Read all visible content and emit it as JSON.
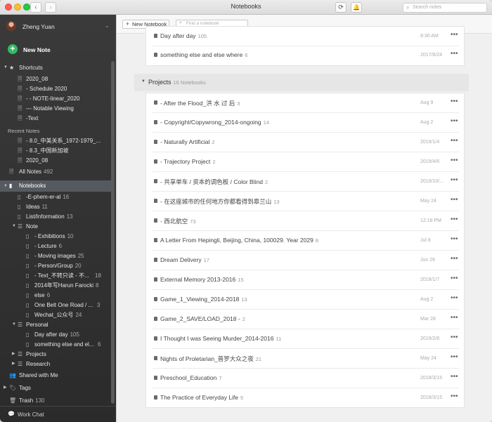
{
  "window": {
    "title": "Notebooks"
  },
  "toolbar": {
    "search_placeholder": "Search notes",
    "back_glyph": "‹",
    "forward_glyph": "›",
    "sync_glyph": "⟳",
    "bell_glyph": "🔔"
  },
  "account": {
    "name": "Zheng Yuan"
  },
  "sidebar": {
    "new_note": "New Note",
    "shortcuts_label": "Shortcuts",
    "shortcuts": [
      "2020_08",
      "- Schedule 2020",
      "- - NOTE-linear_2020",
      "--- Notable Viewing",
      "-Text"
    ],
    "recent_label": "Recent Notes",
    "recent": [
      "- 8.0_中美关系_1972-1979_...",
      "- 8.3_中国新加坡",
      "2020_08"
    ],
    "all_notes": {
      "label": "All Notes",
      "count": "492"
    },
    "notebooks_label": "Notebooks",
    "tree": [
      {
        "name": "-E-phem-er-al",
        "count": "16"
      },
      {
        "name": "Ideas",
        "count": "11"
      },
      {
        "name": "List/Information",
        "count": "13"
      },
      {
        "name": "Note",
        "count": ""
      },
      {
        "name": "- Exhibitions",
        "count": "10"
      },
      {
        "name": "- Lecture",
        "count": "6"
      },
      {
        "name": "- Moving images",
        "count": "25"
      },
      {
        "name": "- Person/Group",
        "count": "20"
      },
      {
        "name": "- Text_不转只读 - 不...",
        "count": "18"
      },
      {
        "name": "2014年写Harun Farocki",
        "count": "8"
      },
      {
        "name": "else",
        "count": "6"
      },
      {
        "name": "One Belt One Road / ...",
        "count": "3"
      },
      {
        "name": "Wechat_公众号",
        "count": "24"
      },
      {
        "name": "Personal",
        "count": ""
      },
      {
        "name": "Day after day",
        "count": "105"
      },
      {
        "name": "something else and el...",
        "count": "6"
      },
      {
        "name": "Projects",
        "count": ""
      },
      {
        "name": "Research",
        "count": ""
      }
    ],
    "shared": "Shared with Me",
    "tags": "Tags",
    "trash": {
      "label": "Trash",
      "count": "130"
    },
    "work_chat": "Work Chat"
  },
  "main": {
    "new_notebook": "New Notebook",
    "find_placeholder": "Find a notebook",
    "personal_rows": [
      {
        "name": "Day after day",
        "count": "105",
        "date": "8:30 AM"
      },
      {
        "name": "something else and else where",
        "count": "6",
        "date": "2017/6/24"
      }
    ],
    "projects_stack": {
      "name": "Projects",
      "count": "16 Notebooks"
    },
    "project_rows": [
      {
        "name": "- After the Flood_洪 水 过 后",
        "count": "3",
        "date": "Aug 9"
      },
      {
        "name": "- Copyright/Copywrong_2014-ongoing",
        "count": "14",
        "date": "Aug 2"
      },
      {
        "name": "- Naturally Artificial",
        "count": "2",
        "date": "2019/1/4"
      },
      {
        "name": "- Trajectory Project",
        "count": "2",
        "date": "2019/4/6"
      },
      {
        "name": "- 共享单车 / 资本的调色板 / Color Blind",
        "count": "2",
        "date": "2019/10/..."
      },
      {
        "name": "- 在这座城市的任何地方你都看得到皋兰山",
        "count": "13",
        "date": "May 24"
      },
      {
        "name": "- 西北航空",
        "count": "73",
        "date": "12:18 PM"
      },
      {
        "name": "A Letter From Hepingli, Beijing, China, 100029. Year 2029",
        "count": "8",
        "date": "Jul 8"
      },
      {
        "name": "Dream Delivery",
        "count": "17",
        "date": "Jun 26"
      },
      {
        "name": "External Memory 2013-2016",
        "count": "15",
        "date": "2018/1/7"
      },
      {
        "name": "Game_1_Viewing_2014-2018",
        "count": "13",
        "date": "Aug 2"
      },
      {
        "name": "Game_2_SAVE/LOAD_2018 -",
        "count": "2",
        "date": "Mar 28"
      },
      {
        "name": "I Thought I was Seeing Murder_2014-2016",
        "count": "11",
        "date": "2019/2/6"
      },
      {
        "name": "Nights of Proletarian_普罗大众之夜",
        "count": "21",
        "date": "May 24"
      },
      {
        "name": "Preschool_Education",
        "count": "7",
        "date": "2018/3/15"
      },
      {
        "name": "The Practice of Everyday Life",
        "count": "5",
        "date": "2018/3/15"
      }
    ],
    "more_glyph": "•••"
  }
}
